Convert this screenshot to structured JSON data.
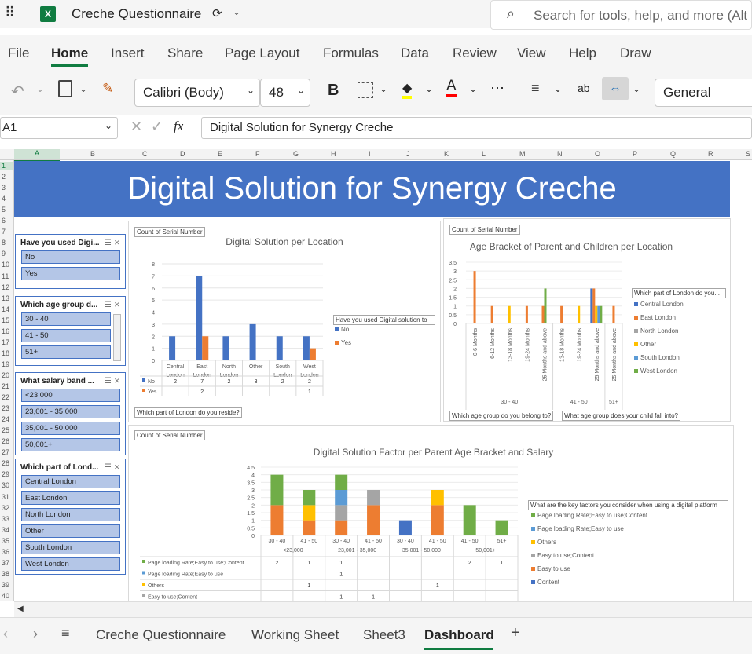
{
  "app": {
    "title": "Creche Questionnaire",
    "search_placeholder": "Search for tools, help, and more (Alt"
  },
  "ribbon_tabs": [
    "File",
    "Home",
    "Insert",
    "Share",
    "Page Layout",
    "Formulas",
    "Data",
    "Review",
    "View",
    "Help",
    "Draw"
  ],
  "toolbar": {
    "font_name": "Calibri (Body)",
    "font_size": "48",
    "bold": "B",
    "number_format": "General"
  },
  "formula_bar": {
    "cell_ref": "A1",
    "formula": "Digital Solution for Synergy Creche"
  },
  "columns": [
    "A",
    "B",
    "C",
    "D",
    "E",
    "F",
    "G",
    "H",
    "I",
    "J",
    "K",
    "L",
    "M",
    "N",
    "O",
    "P",
    "Q",
    "R",
    "S"
  ],
  "rows": [
    "1",
    "2",
    "3",
    "4",
    "5",
    "6",
    "7",
    "8",
    "9",
    "10",
    "11",
    "12",
    "13",
    "14",
    "15",
    "16",
    "17",
    "18",
    "19",
    "20",
    "21",
    "22",
    "23",
    "24",
    "25",
    "26",
    "27",
    "28",
    "29",
    "30",
    "31",
    "32",
    "33",
    "34",
    "35",
    "36",
    "37",
    "38",
    "39",
    "40"
  ],
  "banner_title": "Digital Solution for Synergy Creche",
  "slicers": [
    {
      "header": "Have you used Digi...",
      "items": [
        "No",
        "Yes"
      ]
    },
    {
      "header": "Which age group d...",
      "items": [
        "30 - 40",
        "41 - 50",
        "51+"
      ]
    },
    {
      "header": "What salary band ...",
      "items": [
        "<23,000",
        "23,001 - 35,000",
        "35,001 - 50,000",
        "50,001+"
      ]
    },
    {
      "header": "Which part of Lond...",
      "items": [
        "Central London",
        "East London",
        "North London",
        "Other",
        "South London",
        "West London"
      ]
    }
  ],
  "chart1": {
    "field_btn": "Count of Serial Number",
    "title": "Digital Solution per Location",
    "legend_btn": "Have you used Digital solution to",
    "axis_btn": "Which part of London do you reside?",
    "chart_data": {
      "type": "bar",
      "categories": [
        "Central London",
        "East London",
        "North London",
        "Other",
        "South London",
        "West London"
      ],
      "series": [
        {
          "name": "No",
          "values": [
            2,
            7,
            2,
            3,
            2,
            2
          ],
          "color": "#4472c4"
        },
        {
          "name": "Yes",
          "values": [
            0,
            2,
            0,
            0,
            0,
            1
          ],
          "color": "#ed7d31"
        }
      ],
      "ylim": [
        0,
        8
      ],
      "yticks": [
        "0",
        "1",
        "2",
        "3",
        "4",
        "5",
        "6",
        "7",
        "8"
      ],
      "table_rows": [
        {
          "label": "No",
          "cells": [
            "2",
            "7",
            "2",
            "3",
            "2",
            "2"
          ]
        },
        {
          "label": "Yes",
          "cells": [
            "",
            "2",
            "",
            "",
            "",
            "1"
          ]
        }
      ]
    }
  },
  "chart2": {
    "field_btn": "Count of Serial Number",
    "title": "Age  Bracket of Parent and Children per Location",
    "legend_btn": "Which part of London do you...",
    "axis_btn1": "Which age group do you belong to?",
    "axis_btn2": "What age group does your child fall into?",
    "legend": [
      {
        "name": "Central London",
        "color": "#4472c4"
      },
      {
        "name": "East London",
        "color": "#ed7d31"
      },
      {
        "name": "North London",
        "color": "#a5a5a5"
      },
      {
        "name": "Other",
        "color": "#ffc000"
      },
      {
        "name": "South London",
        "color": "#5b9bd5"
      },
      {
        "name": "West London",
        "color": "#70ad47"
      }
    ],
    "chart_data": {
      "type": "bar",
      "yticks": [
        "0",
        "0.5",
        "1",
        "1.5",
        "2",
        "2.5",
        "3",
        "3.5"
      ],
      "ylim": [
        0,
        3.5
      ],
      "groups": [
        {
          "label": "30 - 40",
          "categories": [
            "0-6 Months",
            "6-12 Months",
            "13-18 Months",
            "19-24 Months",
            "25 Months and above"
          ]
        },
        {
          "label": "41 - 50",
          "categories": [
            "13-18 Months",
            "19-24 Months",
            "25 Months and above"
          ]
        },
        {
          "label": "51+",
          "categories": [
            "25 Months and above"
          ]
        }
      ],
      "bars": [
        [
          {
            "s": 1,
            "v": 3
          }
        ],
        [
          {
            "s": 1,
            "v": 1
          }
        ],
        [
          {
            "s": 3,
            "v": 1
          }
        ],
        [
          {
            "s": 1,
            "v": 1
          }
        ],
        [
          {
            "s": 1,
            "v": 1
          },
          {
            "s": 5,
            "v": 2
          }
        ],
        [
          {
            "s": 1,
            "v": 1
          }
        ],
        [
          {
            "s": 3,
            "v": 1
          }
        ],
        [
          {
            "s": 0,
            "v": 2
          },
          {
            "s": 1,
            "v": 2
          },
          {
            "s": 3,
            "v": 1
          },
          {
            "s": 4,
            "v": 1
          },
          {
            "s": 5,
            "v": 1
          }
        ],
        [
          {
            "s": 1,
            "v": 1
          }
        ]
      ]
    }
  },
  "chart3": {
    "field_btn": "Count of Serial Number",
    "title": "Digital Solution Factor per Parent Age Bracket and Salary",
    "legend_btn": "What are the key factors you consider when using a digital platform",
    "legend": [
      {
        "name": "Page loading Rate;Easy to use;Content",
        "color": "#70ad47"
      },
      {
        "name": "Page loading Rate;Easy to use",
        "color": "#5b9bd5"
      },
      {
        "name": "Others",
        "color": "#ffc000"
      },
      {
        "name": "Easy to use;Content",
        "color": "#a5a5a5"
      },
      {
        "name": "Easy to use",
        "color": "#ed7d31"
      },
      {
        "name": "Content",
        "color": "#4472c4"
      }
    ],
    "chart_data": {
      "type": "bar",
      "ylim": [
        0,
        4.5
      ],
      "yticks": [
        "0",
        "0.5",
        "1",
        "1.5",
        "2",
        "2.5",
        "3",
        "3.5",
        "4",
        "4.5"
      ],
      "categories": [
        "30 - 40",
        "41 - 50",
        "30 - 40",
        "41 - 50",
        "30 - 40",
        "41 - 50",
        "41 - 50",
        "51+"
      ],
      "groups": [
        "<23,000",
        "23,001 - 35,000",
        "35,001 - 50,000",
        "50,001+"
      ],
      "stacks": [
        [
          {
            "s": 4,
            "v": 2
          },
          {
            "s": 0,
            "v": 2
          }
        ],
        [
          {
            "s": 4,
            "v": 1
          },
          {
            "s": 2,
            "v": 1
          },
          {
            "s": 0,
            "v": 1
          }
        ],
        [
          {
            "s": 4,
            "v": 1
          },
          {
            "s": 3,
            "v": 1
          },
          {
            "s": 1,
            "v": 1
          },
          {
            "s": 0,
            "v": 1
          }
        ],
        [
          {
            "s": 4,
            "v": 2
          },
          {
            "s": 3,
            "v": 1
          }
        ],
        [
          {
            "s": 5,
            "v": 1
          }
        ],
        [
          {
            "s": 4,
            "v": 2
          },
          {
            "s": 2,
            "v": 1
          }
        ],
        [
          {
            "s": 0,
            "v": 2
          }
        ],
        [
          {
            "s": 0,
            "v": 1
          }
        ]
      ],
      "table_rows": [
        {
          "label": "Page loading Rate;Easy to use;Content",
          "color": "#70ad47",
          "cells": [
            "2",
            "1",
            "1",
            "",
            "",
            "",
            "2",
            "1"
          ]
        },
        {
          "label": "Page loading Rate;Easy to use",
          "color": "#5b9bd5",
          "cells": [
            "",
            "",
            "1",
            "",
            "",
            "",
            "",
            ""
          ]
        },
        {
          "label": "Others",
          "color": "#ffc000",
          "cells": [
            "",
            "1",
            "",
            "",
            "",
            "1",
            "",
            ""
          ]
        },
        {
          "label": "Easy to use;Content",
          "color": "#a5a5a5",
          "cells": [
            "",
            "",
            "1",
            "1",
            "",
            "",
            "",
            ""
          ]
        }
      ]
    }
  },
  "sheet_tabs": [
    "Creche Questionnaire",
    "Working Sheet",
    "Sheet3",
    "Dashboard"
  ],
  "active_sheet": "Dashboard"
}
